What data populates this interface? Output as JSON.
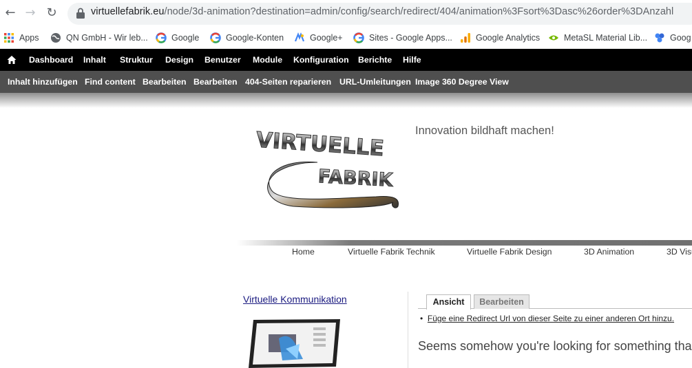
{
  "browser": {
    "url_host": "virtuellefabrik.eu",
    "url_path": "/node/3d-animation?destination=admin/config/search/redirect/404/animation%3Fsort%3Dasc%26order%3DAnzahl"
  },
  "bookmarks": [
    {
      "label": "Apps",
      "icon": "apps-grid-icon"
    },
    {
      "label": "QN GmbH - Wir leb...",
      "icon": "globe-icon"
    },
    {
      "label": "Google",
      "icon": "google-icon"
    },
    {
      "label": "Google-Konten",
      "icon": "google-icon"
    },
    {
      "label": "Google+",
      "icon": "google-plus-icon"
    },
    {
      "label": "Sites - Google Apps...",
      "icon": "google-icon"
    },
    {
      "label": "Google Analytics",
      "icon": "analytics-icon"
    },
    {
      "label": "MetaSL Material Lib...",
      "icon": "nvidia-icon"
    },
    {
      "label": "Goog",
      "icon": "google-apps-icon"
    }
  ],
  "admin_toolbar": [
    "Dashboard",
    "Inhalt",
    "Struktur",
    "Design",
    "Benutzer",
    "Module",
    "Konfiguration",
    "Berichte",
    "Hilfe"
  ],
  "shortcuts": [
    "Inhalt hinzufügen",
    "Find content",
    "Bearbeiten",
    "Bearbeiten",
    "404-Seiten reparieren",
    "URL-Umleitungen",
    "Image 360 Degree View"
  ],
  "site": {
    "logo_line1": "VIRTUELLE",
    "logo_line2": "FABRIK",
    "slogan": "Innovation bildhaft machen!",
    "nav": [
      "Home",
      "Virtuelle Fabrik Technik",
      "Virtuelle Fabrik Design",
      "3D Animation",
      "3D Visu"
    ]
  },
  "sidebar": {
    "link": "Virtuelle Kommunikation"
  },
  "content": {
    "tabs": [
      "Ansicht",
      "Bearbeiten"
    ],
    "action_link": "Füge eine Redirect Url von dieser Seite zu einer anderen Ort hinzu.",
    "message": "Seems somehow you're looking for something tha"
  },
  "colors": {
    "toolbar_bg": "#000000",
    "shortcut_bg": "#4f4f4f",
    "link": "#1a1a80"
  }
}
